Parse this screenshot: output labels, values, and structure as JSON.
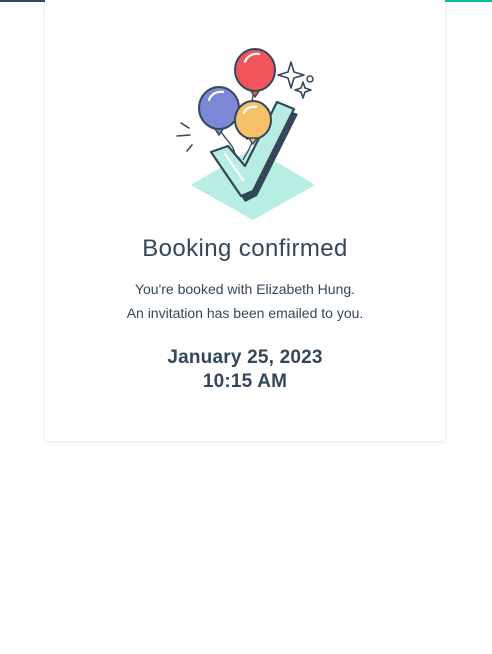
{
  "progress": {
    "percent": 81,
    "track_color": "#33475b",
    "fill_color": "#00bda5"
  },
  "confirmation": {
    "illustration_icon": "balloons-checkmark-icon",
    "title": "Booking confirmed",
    "message_line1": "You're booked with Elizabeth Hung.",
    "message_line2": "An invitation has been emailed to you.",
    "date": "January 25, 2023",
    "time": "10:15 AM"
  },
  "colors": {
    "text": "#33475b",
    "accent_teal": "#00bda5",
    "balloon_red": "#f2545b",
    "balloon_purple": "#7c87d6",
    "balloon_orange": "#f5c26b"
  }
}
